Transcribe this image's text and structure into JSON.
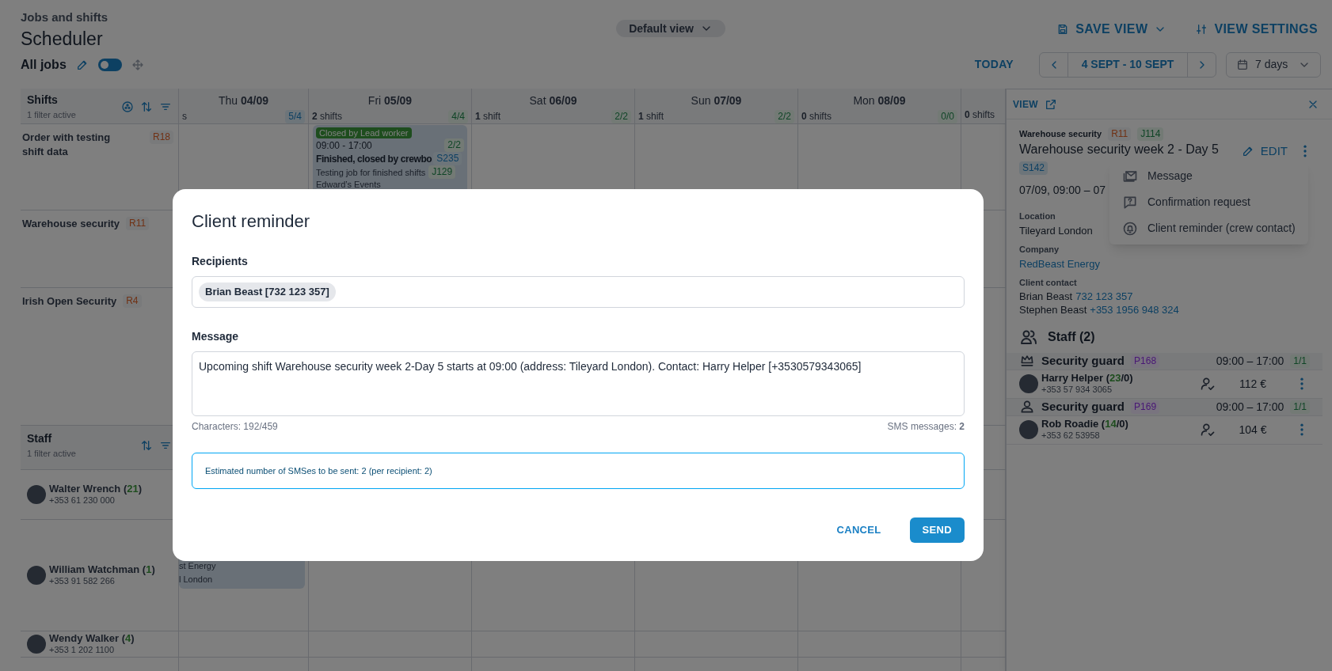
{
  "header": {
    "breadcrumb": "Jobs and shifts",
    "title": "Scheduler",
    "view_selector": "Default view",
    "save_view": "SAVE VIEW",
    "view_settings": "VIEW SETTINGS"
  },
  "toolbar": {
    "jobs_label": "All jobs",
    "toggle_on": false,
    "today": "TODAY",
    "range": "4 SEPT - 10 SEPT",
    "period": "7 days"
  },
  "shifts_header": {
    "title": "Shifts",
    "subtitle": "1 filter active"
  },
  "days": [
    {
      "label": "Thu **04/09**",
      "count": "s",
      "ratio": "5/4",
      "over_capacity": true
    },
    {
      "label": "Fri **05/09**",
      "count": "**2** shifts",
      "ratio": "4/4",
      "over_capacity": false
    },
    {
      "label": "Sat **06/09**",
      "count": "**1** shift",
      "ratio": "2/2",
      "over_capacity": false
    },
    {
      "label": "Sun **07/09**",
      "count": "**1** shift",
      "ratio": "2/2",
      "over_capacity": false
    },
    {
      "label": "Mon **08/09**",
      "count": "**0** shifts",
      "ratio": "0/0",
      "over_capacity": false
    },
    {
      "count": "**0** shifts"
    }
  ],
  "shift_rows": [
    {
      "name": "Order with testing shift data",
      "code": "R18"
    },
    {
      "name": "Warehouse security",
      "code": "R11"
    },
    {
      "name": "Irish Open Security",
      "code": "R4"
    }
  ],
  "shift_card": {
    "status": "Closed by Lead worker",
    "time": "09:00 - 17:00",
    "ratio": "2/2",
    "title": "Finished, closed by crewbo",
    "shift_code": "S235",
    "job": "Testing job for finished shifts",
    "job_code": "J129",
    "client": "Edward’s Events"
  },
  "staff_header": {
    "title": "Staff",
    "subtitle": "1 filter active"
  },
  "staff_rows": [
    {
      "name_parts": [
        "Walter Wrench (",
        "21",
        ")"
      ],
      "phone": "+353 61 230 000"
    },
    {
      "name_parts": [
        "William Watchman (",
        "1",
        ")"
      ],
      "phone": "+353 91 582 266"
    },
    {
      "name_parts": [
        "Wendy Walker (",
        "4",
        ")"
      ],
      "phone": "+353 1 202 1100"
    }
  ],
  "staff_card": {
    "lines": [
      "st Energy",
      "l London"
    ]
  },
  "panel": {
    "view": "VIEW",
    "job": "Warehouse security",
    "role_code": "R11",
    "job_code": "J114",
    "title": "Warehouse security week 2 - Day 5",
    "shift_code": "S142",
    "edit": "EDIT",
    "datetime": "07/09, 09:00 – 07",
    "location_label": "Location",
    "location": "Tileyard London",
    "company_label": "Company",
    "company": "RedBeast Energy",
    "contact_label": "Client contact",
    "contacts": [
      {
        "name": "Brian Beast",
        "phone": "732 123 357"
      },
      {
        "name": "Stephen Beast",
        "phone": "+353 1956 948 324"
      }
    ],
    "staff_title": "Staff (2)",
    "positions": [
      {
        "kind": "lead",
        "role": "Security guard",
        "code": "P168",
        "time": "09:00 – 17:00",
        "ratio": "1/1",
        "worker": {
          "name_parts": [
            "Harry Helper (",
            "23",
            "/0)"
          ],
          "phone": "+353 57 934 3065",
          "pay": "112 €"
        }
      },
      {
        "kind": "regular",
        "role": "Security guard",
        "code": "P169",
        "time": "09:00 – 17:00",
        "ratio": "1/1",
        "worker": {
          "name_parts": [
            "Rob Roadie (",
            "14",
            "/0)"
          ],
          "phone": "+353 62 53958",
          "pay": "104 €"
        }
      }
    ]
  },
  "menu": [
    {
      "kind": "message",
      "label": "Message"
    },
    {
      "kind": "confirmation",
      "label": "Confirmation request"
    },
    {
      "kind": "reminder",
      "label": "Client reminder (crew contact)"
    }
  ],
  "modal": {
    "title": "Client reminder",
    "recipients_label": "Recipients",
    "recipients": [
      "Brian Beast [732 123 357]"
    ],
    "message_label": "Message",
    "message": "Upcoming shift Warehouse security week 2-Day 5 starts at 09:00 (address: Tileyard London). Contact: Harry Helper [+3530579343065]",
    "characters": "Characters: 192/459",
    "sms": "SMS messages: **2**",
    "info": "Estimated number of SMSes to be sent: 2 (per recipient: 2)",
    "cancel": "CANCEL",
    "send": "SEND"
  }
}
